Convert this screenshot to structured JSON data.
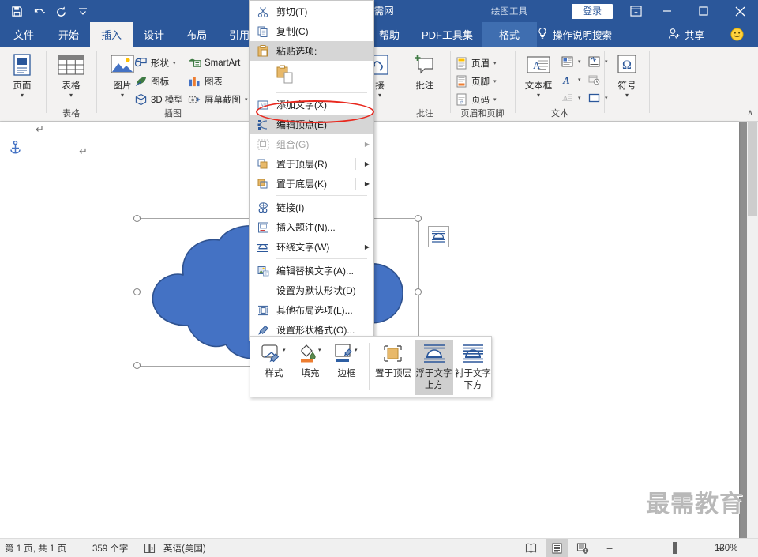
{
  "titlebar": {
    "doc_title": "最需网",
    "signin_label": "登录",
    "qat": [
      {
        "name": "save-icon",
        "label": "保存"
      },
      {
        "name": "undo-icon",
        "label": "撤消"
      },
      {
        "name": "redo-icon",
        "label": "恢复"
      },
      {
        "name": "customize-qat-icon",
        "label": "自定义快速访问工具栏"
      }
    ],
    "window_buttons": [
      {
        "name": "ribbon-display-options-icon",
        "label": "功能区显示选项"
      },
      {
        "name": "minimize-icon",
        "label": "最小化"
      },
      {
        "name": "maximize-icon",
        "label": "最大化"
      },
      {
        "name": "close-icon",
        "label": "关闭"
      }
    ]
  },
  "tabs": {
    "items": [
      {
        "label": "文件",
        "active": false
      },
      {
        "label": "开始",
        "active": false
      },
      {
        "label": "插入",
        "active": true
      },
      {
        "label": "设计",
        "active": false
      },
      {
        "label": "布局",
        "active": false
      },
      {
        "label": "引用",
        "active": false
      },
      {
        "label": "帮助",
        "active": false
      },
      {
        "label": "PDF工具集",
        "active": false
      },
      {
        "label": "格式",
        "active": false,
        "contextual": true
      }
    ],
    "contextual_label": "绘图工具",
    "tellme": "操作说明搜索",
    "share": "共享"
  },
  "ribbon": {
    "groups": [
      {
        "label": "页面",
        "group_label": "",
        "buttons": [
          {
            "label": "页面",
            "icon": "cover-page-icon",
            "dropdown": true
          }
        ]
      },
      {
        "label": "表格",
        "group_label": "表格",
        "buttons": [
          {
            "label": "表格",
            "icon": "table-icon",
            "dropdown": true
          }
        ]
      },
      {
        "label": "插图",
        "group_label": "插图",
        "buttons": [
          {
            "label": "图片",
            "icon": "picture-icon",
            "dropdown": true
          },
          {
            "label": "形状",
            "icon": "shapes-icon",
            "dropdown": true
          },
          {
            "label": "图标",
            "icon": "icons-icon",
            "dropdown": false
          },
          {
            "label": "3D 模型",
            "icon": "3d-model-icon",
            "dropdown": false
          },
          {
            "label": "SmartArt",
            "icon": "smartart-icon",
            "dropdown": false
          },
          {
            "label": "图表",
            "icon": "chart-icon",
            "dropdown": false
          },
          {
            "label": "屏幕截图",
            "icon": "screenshot-icon",
            "dropdown": true
          }
        ]
      },
      {
        "label": "链接",
        "group_label": "",
        "buttons": [
          {
            "label": "接",
            "icon": "link-icon",
            "dropdown": true
          }
        ]
      },
      {
        "label": "批注",
        "group_label": "批注",
        "buttons": [
          {
            "label": "批注",
            "icon": "comment-icon",
            "dropdown": false
          }
        ]
      },
      {
        "label": "页眉和页脚",
        "group_label": "页眉和页脚",
        "buttons": [
          {
            "label": "页眉",
            "icon": "header-icon",
            "dropdown": true
          },
          {
            "label": "页脚",
            "icon": "footer-icon",
            "dropdown": true
          },
          {
            "label": "页码",
            "icon": "page-number-icon",
            "dropdown": true
          }
        ]
      },
      {
        "label": "文本",
        "group_label": "文本",
        "buttons": [
          {
            "label": "文本框",
            "icon": "text-box-icon",
            "dropdown": true
          },
          {
            "label": "",
            "icon": "quick-parts-icon",
            "dropdown": true
          },
          {
            "label": "",
            "icon": "wordart-icon",
            "dropdown": true
          },
          {
            "label": "",
            "icon": "drop-cap-icon",
            "dropdown": true
          },
          {
            "label": "",
            "icon": "signature-line-icon",
            "dropdown": true
          },
          {
            "label": "",
            "icon": "date-time-icon",
            "dropdown": false
          },
          {
            "label": "",
            "icon": "object-icon",
            "dropdown": true
          }
        ]
      },
      {
        "label": "符号",
        "group_label": "",
        "buttons": [
          {
            "label": "符号",
            "icon": "symbol-icon",
            "dropdown": true
          }
        ]
      }
    ],
    "collapse_label": "∧"
  },
  "context_menu": {
    "items": [
      {
        "label": "剪切(T)",
        "icon": "cut-icon",
        "state": "normal",
        "submenu": false
      },
      {
        "label": "复制(C)",
        "icon": "copy-icon",
        "state": "normal",
        "submenu": false
      },
      {
        "label": "粘贴选项:",
        "icon": "paste-icon",
        "state": "highlight",
        "submenu": false
      },
      {
        "label": "",
        "icon": "paste-keep-formatting-icon",
        "state": "paste-row",
        "submenu": false
      },
      {
        "label": "添加文字(X)",
        "icon": "add-text-icon",
        "state": "normal",
        "submenu": false
      },
      {
        "label": "编辑顶点(E)",
        "icon": "edit-points-icon",
        "state": "highlight",
        "submenu": false
      },
      {
        "label": "组合(G)",
        "icon": "group-icon",
        "state": "disabled",
        "submenu": true
      },
      {
        "label": "置于顶层(R)",
        "icon": "bring-to-front-icon",
        "state": "normal",
        "submenu": true
      },
      {
        "label": "置于底层(K)",
        "icon": "send-to-back-icon",
        "state": "normal",
        "submenu": true
      },
      {
        "label": "链接(I)",
        "icon": "hyperlink-icon",
        "state": "normal",
        "submenu": false
      },
      {
        "label": "插入题注(N)...",
        "icon": "insert-caption-icon",
        "state": "normal",
        "submenu": false
      },
      {
        "label": "环绕文字(W)",
        "icon": "wrap-text-icon",
        "state": "normal",
        "submenu": true
      },
      {
        "label": "编辑替换文字(A)...",
        "icon": "edit-alt-text-icon",
        "state": "normal",
        "submenu": false
      },
      {
        "label": "设置为默认形状(D)",
        "icon": "",
        "state": "normal",
        "submenu": false
      },
      {
        "label": "其他布局选项(L)...",
        "icon": "more-layout-options-icon",
        "state": "normal",
        "submenu": false
      },
      {
        "label": "设置形状格式(O)...",
        "icon": "format-shape-icon",
        "state": "normal",
        "submenu": false
      }
    ],
    "annotation": {
      "name": "red-ellipse-highlight",
      "target": "编辑顶点(E)",
      "color": "#e8281e"
    }
  },
  "mini_toolbar": {
    "items": [
      {
        "label": "样式",
        "icon": "shape-style-icon",
        "dropdown": true,
        "selected": false
      },
      {
        "label": "填充",
        "icon": "shape-fill-icon",
        "dropdown": true,
        "selected": false,
        "color": "#ed7d31"
      },
      {
        "label": "边框",
        "icon": "shape-outline-icon",
        "dropdown": true,
        "selected": false,
        "color": "#2e5fa3"
      },
      {
        "label": "置于顶层",
        "icon": "bring-to-front-icon",
        "dropdown": false,
        "selected": false
      },
      {
        "label": "浮于文字上方",
        "icon": "in-front-of-text-icon",
        "dropdown": false,
        "selected": true
      },
      {
        "label": "衬于文字下方",
        "icon": "behind-text-icon",
        "dropdown": false,
        "selected": false
      }
    ]
  },
  "canvas": {
    "shape": {
      "name": "cloud-shape",
      "fill": "#4472c4",
      "outline": "#2f528f"
    },
    "layout_options_label": "布局选项",
    "anchor_label": "对象锚点",
    "paragraph_marks": 2
  },
  "status_bar": {
    "page_info": "第 1 页, 共 1 页",
    "word_count": "359 个字",
    "proofing_icon": "proofing-errors-icon",
    "language": "英语(美国)",
    "views": [
      {
        "name": "read-mode-icon",
        "label": "阅读视图",
        "active": false
      },
      {
        "name": "print-layout-icon",
        "label": "页面视图",
        "active": true
      },
      {
        "name": "web-layout-icon",
        "label": "Web 版式视图",
        "active": false
      }
    ],
    "zoom_out_label": "−",
    "zoom_in_label": "+",
    "zoom_level": "130%"
  },
  "watermark": "最需教育"
}
